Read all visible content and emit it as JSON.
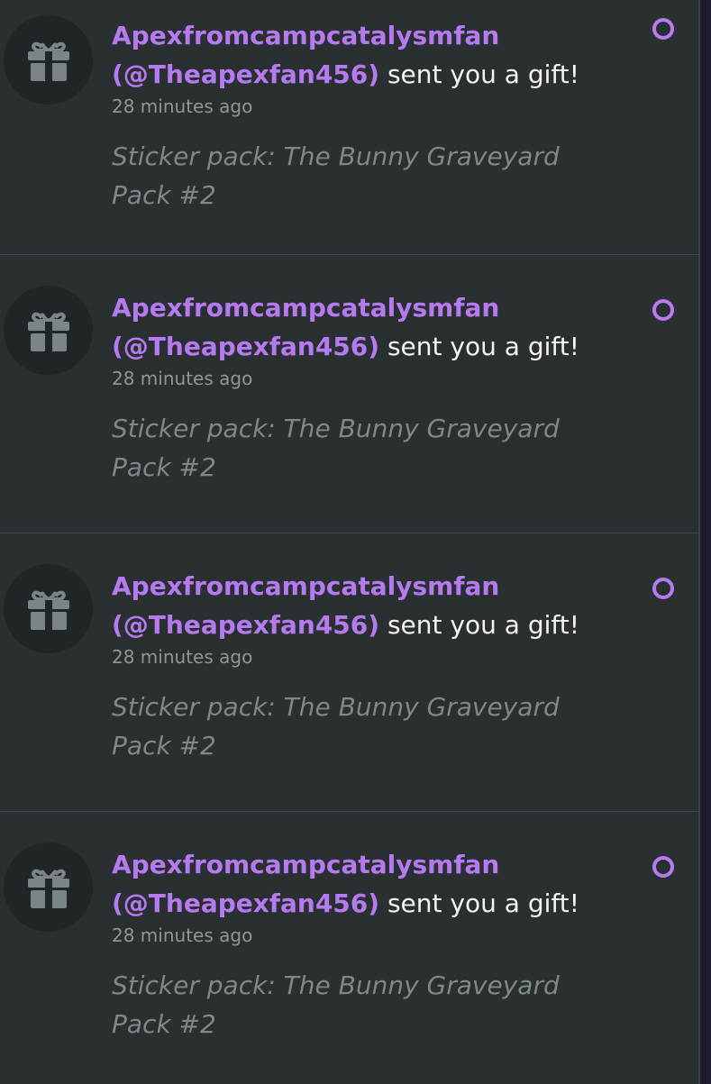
{
  "accent_color": "#b67af0",
  "notifications": [
    {
      "icon": "gift-icon",
      "sender": "Apexfromcampcatalysmfan (@Theapexfan456)",
      "action": "sent you a gift!",
      "time": "28 minutes ago",
      "description": "Sticker pack: The Bunny Graveyard Pack #2",
      "unread": true
    },
    {
      "icon": "gift-icon",
      "sender": "Apexfromcampcatalysmfan (@Theapexfan456)",
      "action": "sent you a gift!",
      "time": "28 minutes ago",
      "description": "Sticker pack: The Bunny Graveyard Pack #2",
      "unread": true
    },
    {
      "icon": "gift-icon",
      "sender": "Apexfromcampcatalysmfan (@Theapexfan456)",
      "action": "sent you a gift!",
      "time": "28 minutes ago",
      "description": "Sticker pack: The Bunny Graveyard Pack #2",
      "unread": true
    },
    {
      "icon": "gift-icon",
      "sender": "Apexfromcampcatalysmfan (@Theapexfan456)",
      "action": "sent you a gift!",
      "time": "28 minutes ago",
      "description": "Sticker pack: The Bunny Graveyard Pack #2",
      "unread": true
    }
  ]
}
